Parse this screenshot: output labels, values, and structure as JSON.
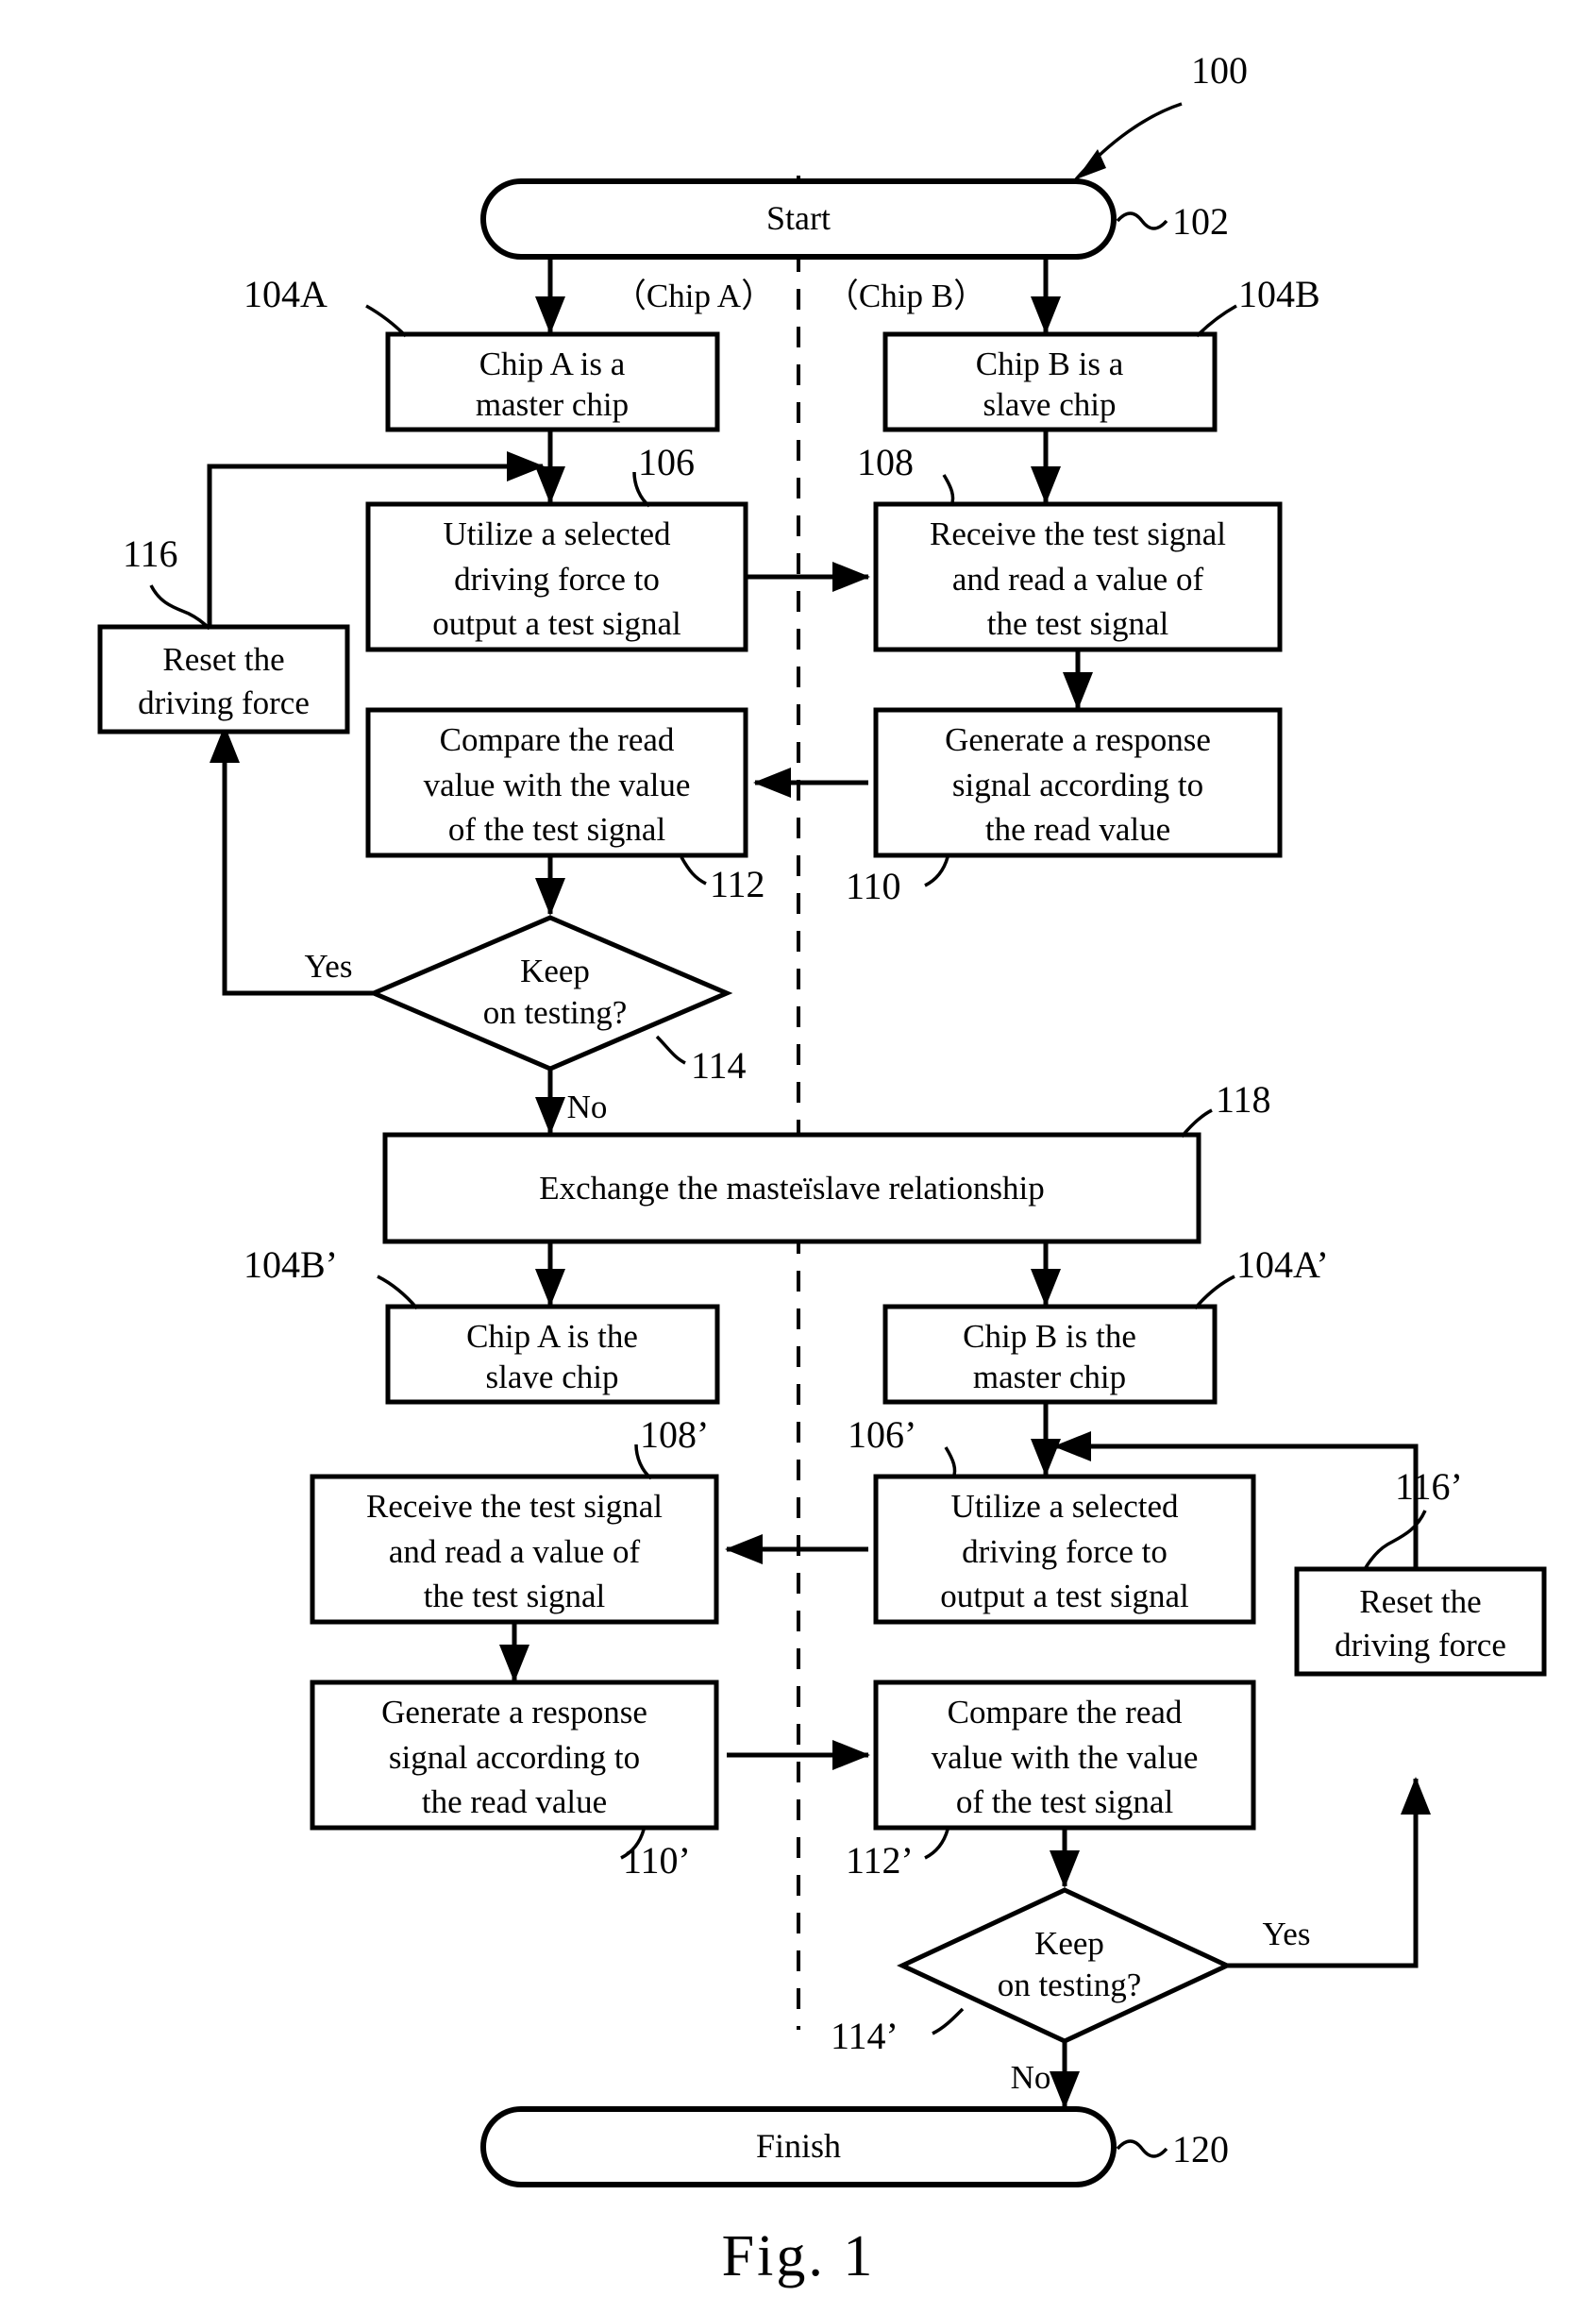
{
  "figure": {
    "caption": "Fig.  1",
    "overall_ref": "100"
  },
  "lanes": {
    "left": "（Chip A）",
    "right": "（Chip B）"
  },
  "terminals": [
    {
      "id": "start",
      "label": "Start",
      "ref": "102"
    },
    {
      "id": "finish",
      "label": "Finish",
      "ref": "120"
    }
  ],
  "nodes": {
    "n104A": {
      "ref": "104A",
      "line1": "Chip A is a",
      "line2": "master chip"
    },
    "n104B": {
      "ref": "104B",
      "line1": "Chip B is a",
      "line2": "slave chip"
    },
    "n106": {
      "ref": "106",
      "line1": "Utilize a selected",
      "line2": "driving force to",
      "line3": "output a test signal"
    },
    "n108": {
      "ref": "108",
      "line1": "Receive the test signal",
      "line2": "and read a value of",
      "line3": "the test signal"
    },
    "n110": {
      "ref": "110",
      "line1": "Generate a response",
      "line2": "signal according to",
      "line3": "the read value"
    },
    "n112": {
      "ref": "112",
      "line1": "Compare the read",
      "line2": "value with the value",
      "line3": "of the test signal"
    },
    "n114": {
      "ref": "114",
      "line1": "Keep",
      "line2": "on testing?",
      "yes": "Yes",
      "no": "No"
    },
    "n116": {
      "ref": "116",
      "line1": "Reset the",
      "line2": "driving force"
    },
    "n118": {
      "ref": "118",
      "line1": "Exchange the masteïslave relationship"
    },
    "n104Bp": {
      "ref": "104B’",
      "line1": "Chip A is the",
      "line2": "slave chip"
    },
    "n104Ap": {
      "ref": "104A’",
      "line1": "Chip B is the",
      "line2": "master chip"
    },
    "n106p": {
      "ref": "106’",
      "line1": "Utilize a selected",
      "line2": "driving force to",
      "line3": "output a test signal"
    },
    "n108p": {
      "ref": "108’",
      "line1": "Receive the test signal",
      "line2": "and read a value of",
      "line3": "the test signal"
    },
    "n110p": {
      "ref": "110’",
      "line1": "Generate a response",
      "line2": "signal according to",
      "line3": "the read value"
    },
    "n112p": {
      "ref": "112’",
      "line1": "Compare the read",
      "line2": "value with the value",
      "line3": "of the test signal"
    },
    "n114p": {
      "ref": "114’",
      "line1": "Keep",
      "line2": "on testing?",
      "yes": "Yes",
      "no": "No"
    },
    "n116p": {
      "ref": "116’",
      "line1": "Reset the",
      "line2": "driving force"
    }
  },
  "colors": {
    "ink": "#000000",
    "paper": "#ffffff"
  }
}
